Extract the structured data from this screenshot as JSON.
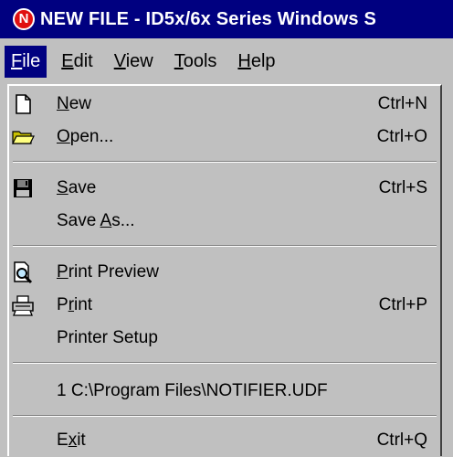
{
  "window": {
    "title": "NEW FILE - ID5x/6x Series Windows S",
    "app_icon": "notifier-logo-icon"
  },
  "menubar": {
    "items": [
      {
        "pre": "",
        "u": "F",
        "post": "ile",
        "active": true
      },
      {
        "pre": "",
        "u": "E",
        "post": "dit",
        "active": false
      },
      {
        "pre": "",
        "u": "V",
        "post": "iew",
        "active": false
      },
      {
        "pre": "",
        "u": "T",
        "post": "ools",
        "active": false
      },
      {
        "pre": "",
        "u": "H",
        "post": "elp",
        "active": false
      }
    ]
  },
  "file_menu": {
    "new": {
      "pre": "",
      "u": "N",
      "post": "ew",
      "shortcut": "Ctrl+N",
      "icon": "new-document-icon"
    },
    "open": {
      "pre": "",
      "u": "O",
      "post": "pen...",
      "shortcut": "Ctrl+O",
      "icon": "folder-open-icon"
    },
    "save": {
      "pre": "",
      "u": "S",
      "post": "ave",
      "shortcut": "Ctrl+S",
      "icon": "floppy-disk-icon"
    },
    "save_as": {
      "pre": "Save ",
      "u": "A",
      "post": "s...",
      "shortcut": ""
    },
    "print_preview": {
      "pre": "",
      "u": "P",
      "post": "rint Preview",
      "shortcut": "",
      "icon": "print-preview-icon"
    },
    "print": {
      "pre": "P",
      "u": "r",
      "post": "int",
      "shortcut": "Ctrl+P",
      "icon": "printer-icon"
    },
    "printer_setup": {
      "pre": "Printer Setup",
      "u": "",
      "post": "",
      "shortcut": ""
    },
    "recent_1": {
      "pre": "1  C:\\Program Files\\NOTIFIER.UDF",
      "u": "",
      "post": "",
      "shortcut": ""
    },
    "exit": {
      "pre": "E",
      "u": "x",
      "post": "it",
      "shortcut": "Ctrl+Q"
    }
  },
  "colors": {
    "titlebar": "#000080",
    "face": "#c0c0c0",
    "highlight": "#000080",
    "logo": "#e01010"
  }
}
